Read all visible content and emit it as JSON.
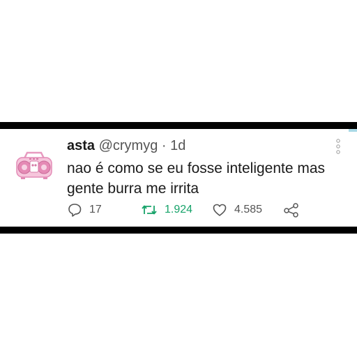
{
  "tweet": {
    "name": "asta",
    "handle": "@crymyg",
    "separator": "·",
    "time": "1d",
    "text_lines": [
      "nao é como se eu fosse inteligente mas",
      "gente burra me irrita"
    ],
    "replies": "17",
    "retweets": "1.924",
    "likes": "4.585"
  },
  "icons": {
    "avatar": "pink-boombox-image",
    "more": "vertical-dots-icon",
    "reply": "reply-icon",
    "retweet": "retweet-icon",
    "like": "heart-icon",
    "share": "share-icon"
  },
  "colors": {
    "retweet_accent": "#17a36a",
    "text": "#1a1a1a",
    "muted": "#555555",
    "accent_strip": "#a9d9e6"
  }
}
